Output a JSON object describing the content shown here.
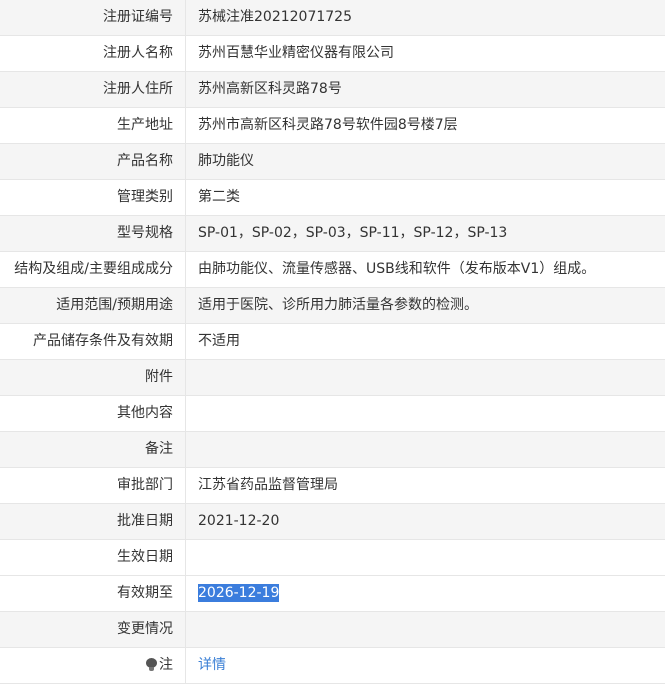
{
  "rows": [
    {
      "label": "注册证编号",
      "value": "苏械注准20212071725"
    },
    {
      "label": "注册人名称",
      "value": "苏州百慧华业精密仪器有限公司"
    },
    {
      "label": "注册人住所",
      "value": "苏州高新区科灵路78号"
    },
    {
      "label": "生产地址",
      "value": "苏州市高新区科灵路78号软件园8号楼7层"
    },
    {
      "label": "产品名称",
      "value": "肺功能仪"
    },
    {
      "label": "管理类别",
      "value": "第二类"
    },
    {
      "label": "型号规格",
      "value": "SP-01，SP-02，SP-03，SP-11，SP-12，SP-13"
    },
    {
      "label": "结构及组成/主要组成成分",
      "value": "由肺功能仪、流量传感器、USB线和软件（发布版本V1）组成。"
    },
    {
      "label": "适用范围/预期用途",
      "value": "适用于医院、诊所用力肺活量各参数的检测。"
    },
    {
      "label": "产品储存条件及有效期",
      "value": "不适用"
    },
    {
      "label": "附件",
      "value": ""
    },
    {
      "label": "其他内容",
      "value": ""
    },
    {
      "label": "备注",
      "value": ""
    },
    {
      "label": "审批部门",
      "value": "江苏省药品监督管理局"
    },
    {
      "label": "批准日期",
      "value": "2021-12-20"
    },
    {
      "label": "生效日期",
      "value": ""
    },
    {
      "label": "有效期至",
      "value": "2026-12-19"
    },
    {
      "label": "变更情况",
      "value": ""
    }
  ],
  "note": {
    "label": "注",
    "icon": "lightbulb-icon",
    "link": "详情"
  },
  "colors": {
    "alt_row": "#f5f5f5",
    "selection": "#3b7ddd",
    "link": "#3a7fd5"
  }
}
